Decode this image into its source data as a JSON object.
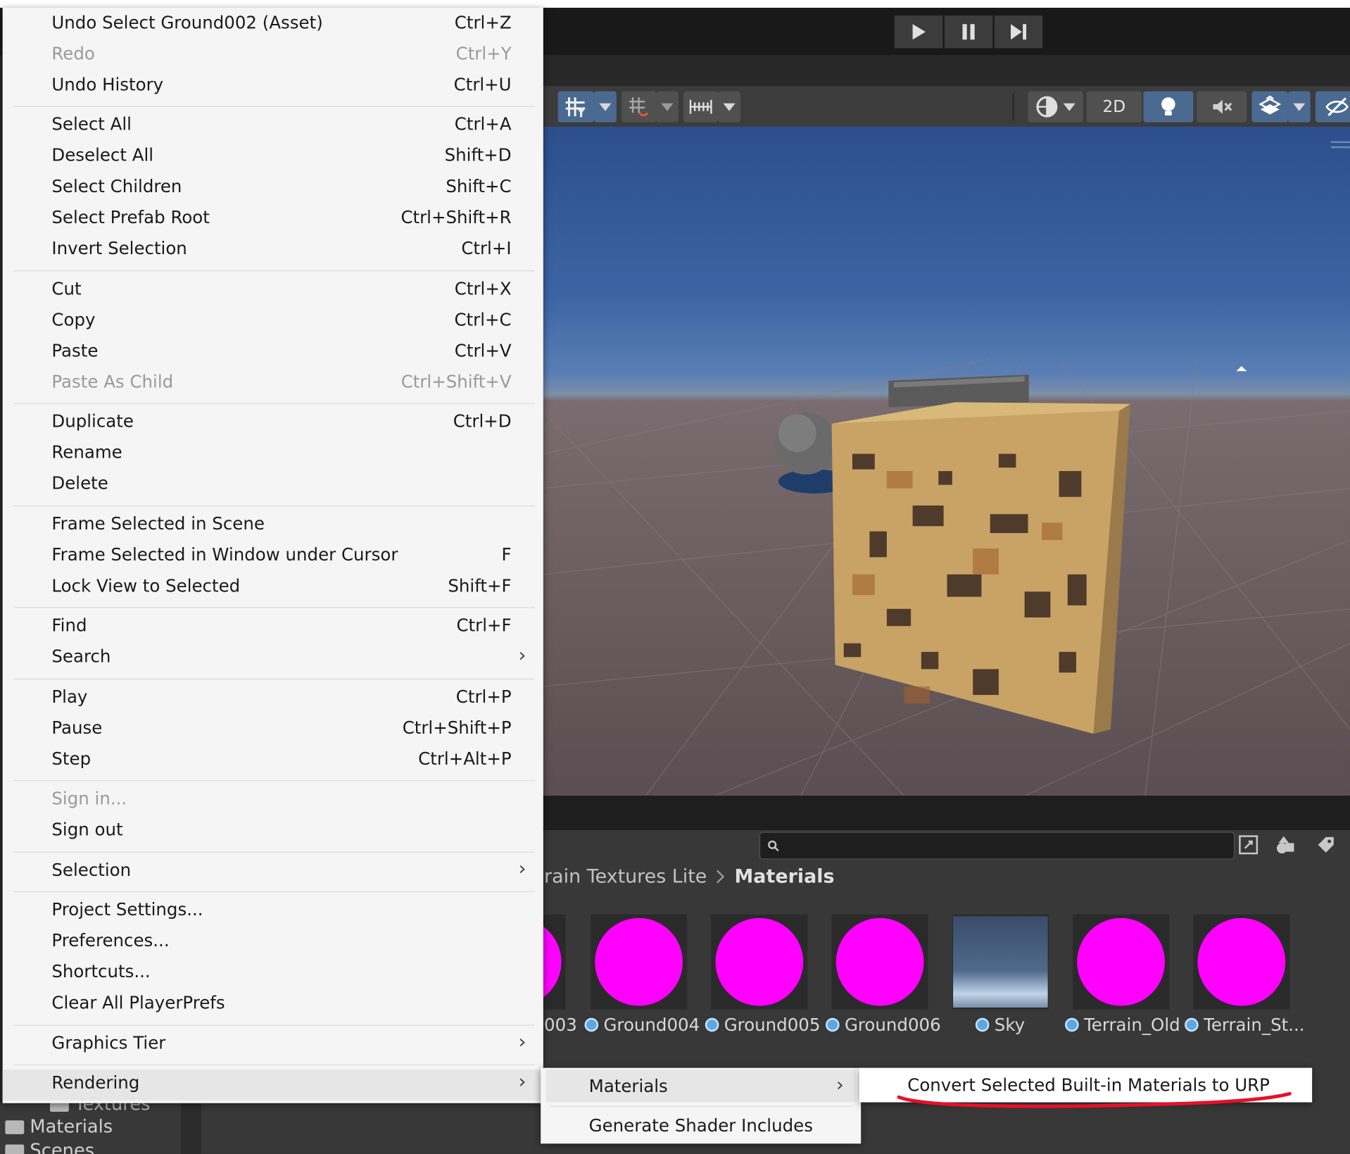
{
  "toolbar": {
    "play_icon": "play-icon",
    "pause_icon": "pause-icon",
    "step_icon": "step-icon",
    "mode_2d": "2D"
  },
  "scene_toolbar": {
    "icons": [
      "grid-snap-icon",
      "increment-snap-icon",
      "ruler-icon",
      "render-mode-icon",
      "lighting-icon",
      "audio-mute-icon",
      "effects-icon",
      "visibility-icon"
    ]
  },
  "edit_menu": {
    "items": [
      {
        "label": "Undo Select Ground002 (Asset)",
        "shortcut": "Ctrl+Z"
      },
      {
        "label": "Redo",
        "shortcut": "Ctrl+Y",
        "disabled": true
      },
      {
        "label": "Undo History",
        "shortcut": "Ctrl+U"
      },
      {
        "label": "Select All",
        "shortcut": "Ctrl+A"
      },
      {
        "label": "Deselect All",
        "shortcut": "Shift+D"
      },
      {
        "label": "Select Children",
        "shortcut": "Shift+C"
      },
      {
        "label": "Select Prefab Root",
        "shortcut": "Ctrl+Shift+R"
      },
      {
        "label": "Invert Selection",
        "shortcut": "Ctrl+I"
      },
      {
        "label": "Cut",
        "shortcut": "Ctrl+X"
      },
      {
        "label": "Copy",
        "shortcut": "Ctrl+C"
      },
      {
        "label": "Paste",
        "shortcut": "Ctrl+V"
      },
      {
        "label": "Paste As Child",
        "shortcut": "Ctrl+Shift+V",
        "disabled": true
      },
      {
        "label": "Duplicate",
        "shortcut": "Ctrl+D"
      },
      {
        "label": "Rename",
        "shortcut": ""
      },
      {
        "label": "Delete",
        "shortcut": ""
      },
      {
        "label": "Frame Selected in Scene",
        "shortcut": ""
      },
      {
        "label": "Frame Selected in Window under Cursor",
        "shortcut": "F"
      },
      {
        "label": "Lock View to Selected",
        "shortcut": "Shift+F"
      },
      {
        "label": "Find",
        "shortcut": "Ctrl+F"
      },
      {
        "label": "Search",
        "shortcut": "",
        "submenu": true
      },
      {
        "label": "Play",
        "shortcut": "Ctrl+P"
      },
      {
        "label": "Pause",
        "shortcut": "Ctrl+Shift+P"
      },
      {
        "label": "Step",
        "shortcut": "Ctrl+Alt+P"
      },
      {
        "label": "Sign in...",
        "shortcut": "",
        "disabled": true
      },
      {
        "label": "Sign out",
        "shortcut": ""
      },
      {
        "label": "Selection",
        "shortcut": "",
        "submenu": true
      },
      {
        "label": "Project Settings...",
        "shortcut": ""
      },
      {
        "label": "Preferences...",
        "shortcut": ""
      },
      {
        "label": "Shortcuts...",
        "shortcut": ""
      },
      {
        "label": "Clear All PlayerPrefs",
        "shortcut": ""
      },
      {
        "label": "Graphics Tier",
        "shortcut": "",
        "submenu": true
      },
      {
        "label": "Rendering",
        "shortcut": "",
        "submenu": true,
        "highlighted": true
      }
    ]
  },
  "rendering_submenu": {
    "items": [
      {
        "label": "Materials",
        "submenu": true,
        "highlighted": true
      },
      {
        "label": "Generate Shader Includes"
      }
    ]
  },
  "materials_submenu": {
    "items": [
      {
        "label": "Convert Selected Built-in Materials to URP"
      }
    ],
    "annotation_color": "#e8102a"
  },
  "project": {
    "search_placeholder": "",
    "breadcrumb": [
      "rain Textures Lite",
      "Materials"
    ],
    "assets": [
      {
        "label": "003",
        "type": "material"
      },
      {
        "label": "Ground004",
        "type": "material"
      },
      {
        "label": "Ground005",
        "type": "material"
      },
      {
        "label": "Ground006",
        "type": "material"
      },
      {
        "label": "Sky",
        "type": "skybox"
      },
      {
        "label": "Terrain_Old",
        "type": "material"
      },
      {
        "label": "Terrain_St...",
        "type": "material"
      }
    ],
    "missing_material_color": "#ff00ff"
  },
  "left_panel": {
    "folders": [
      "Textures",
      "Materials",
      "Scenes"
    ]
  }
}
